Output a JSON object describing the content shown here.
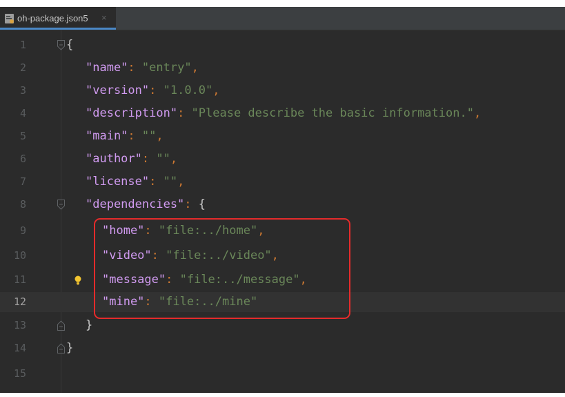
{
  "tab": {
    "label": "oh-package.json5",
    "close": "×"
  },
  "current_line": 12,
  "line_numbers": [
    "1",
    "2",
    "3",
    "4",
    "5",
    "6",
    "7",
    "8",
    "9",
    "10",
    "11",
    "12",
    "13",
    "14",
    "15"
  ],
  "code": {
    "l1": {
      "open": "{"
    },
    "l2": {
      "key": "\"name\"",
      "colon": ": ",
      "value": "\"entry\"",
      "comma": ","
    },
    "l3": {
      "key": "\"version\"",
      "colon": ": ",
      "value": "\"1.0.0\"",
      "comma": ","
    },
    "l4": {
      "key": "\"description\"",
      "colon": ": ",
      "value": "\"Please describe the basic information.\"",
      "comma": ","
    },
    "l5": {
      "key": "\"main\"",
      "colon": ": ",
      "value": "\"\"",
      "comma": ","
    },
    "l6": {
      "key": "\"author\"",
      "colon": ": ",
      "value": "\"\"",
      "comma": ","
    },
    "l7": {
      "key": "\"license\"",
      "colon": ": ",
      "value": "\"\"",
      "comma": ","
    },
    "l8": {
      "key": "\"dependencies\"",
      "colon": ": ",
      "open": "{"
    },
    "l9": {
      "key": "\"home\"",
      "colon": ": ",
      "value": "\"file:../home\"",
      "comma": ","
    },
    "l10": {
      "key": "\"video\"",
      "colon": ": ",
      "value": "\"file:../video\"",
      "comma": ","
    },
    "l11": {
      "key": "\"message\"",
      "colon": ": ",
      "value": "\"file:../message\"",
      "comma": ","
    },
    "l12": {
      "key": "\"mine\"",
      "colon": ": ",
      "value": "\"file:../mine\""
    },
    "l13": {
      "close": "}"
    },
    "l14": {
      "close": "}"
    }
  },
  "colors": {
    "key": "#d19bf1",
    "string": "#6a8759",
    "punctuation": "#cc7832",
    "brace": "#c8c8c8",
    "highlight_box": "#e52b2b",
    "background": "#2b2b2b"
  },
  "icons": [
    "json5-file-icon",
    "close-icon",
    "fold-icon",
    "intention-bulb-icon"
  ]
}
